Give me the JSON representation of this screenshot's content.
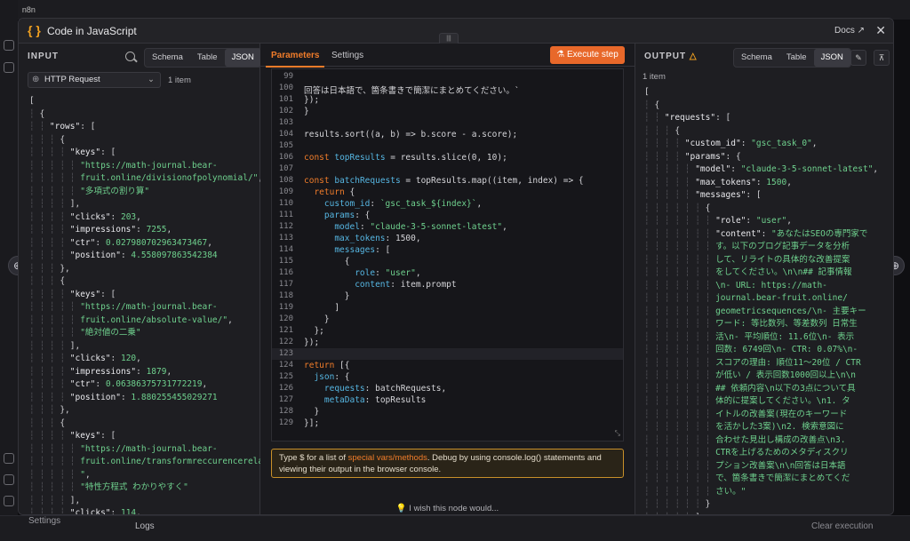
{
  "app": {
    "logo_text": "n8n",
    "logs_label": "Logs",
    "settings_label": "Settings",
    "clear_execution_label": "Clear execution"
  },
  "modal": {
    "title": "Code in JavaScript",
    "docs_label": "Docs ↗",
    "close_icon": "close-icon"
  },
  "input": {
    "header": "INPUT",
    "tabs": [
      "Schema",
      "Table",
      "JSON"
    ],
    "active_tab": "JSON",
    "node_select": "HTTP Request",
    "item_count": "1 item"
  },
  "center": {
    "tabs": [
      "Parameters",
      "Settings"
    ],
    "execute_label": "Execute step",
    "hint_prefix": "Type $ for a list of ",
    "hint_link": "special vars/methods",
    "hint_suffix": ". Debug by using console.log() statements and viewing their output in the browser console.",
    "wish_label": "I wish this node would..."
  },
  "output": {
    "header": "OUTPUT",
    "tabs": [
      "Schema",
      "Table",
      "JSON"
    ],
    "active_tab": "JSON",
    "item_count": "1 item"
  },
  "colors": {
    "accent": "#f07c2a",
    "string": "#6fd18e",
    "keyword": "#f07c2a"
  }
}
